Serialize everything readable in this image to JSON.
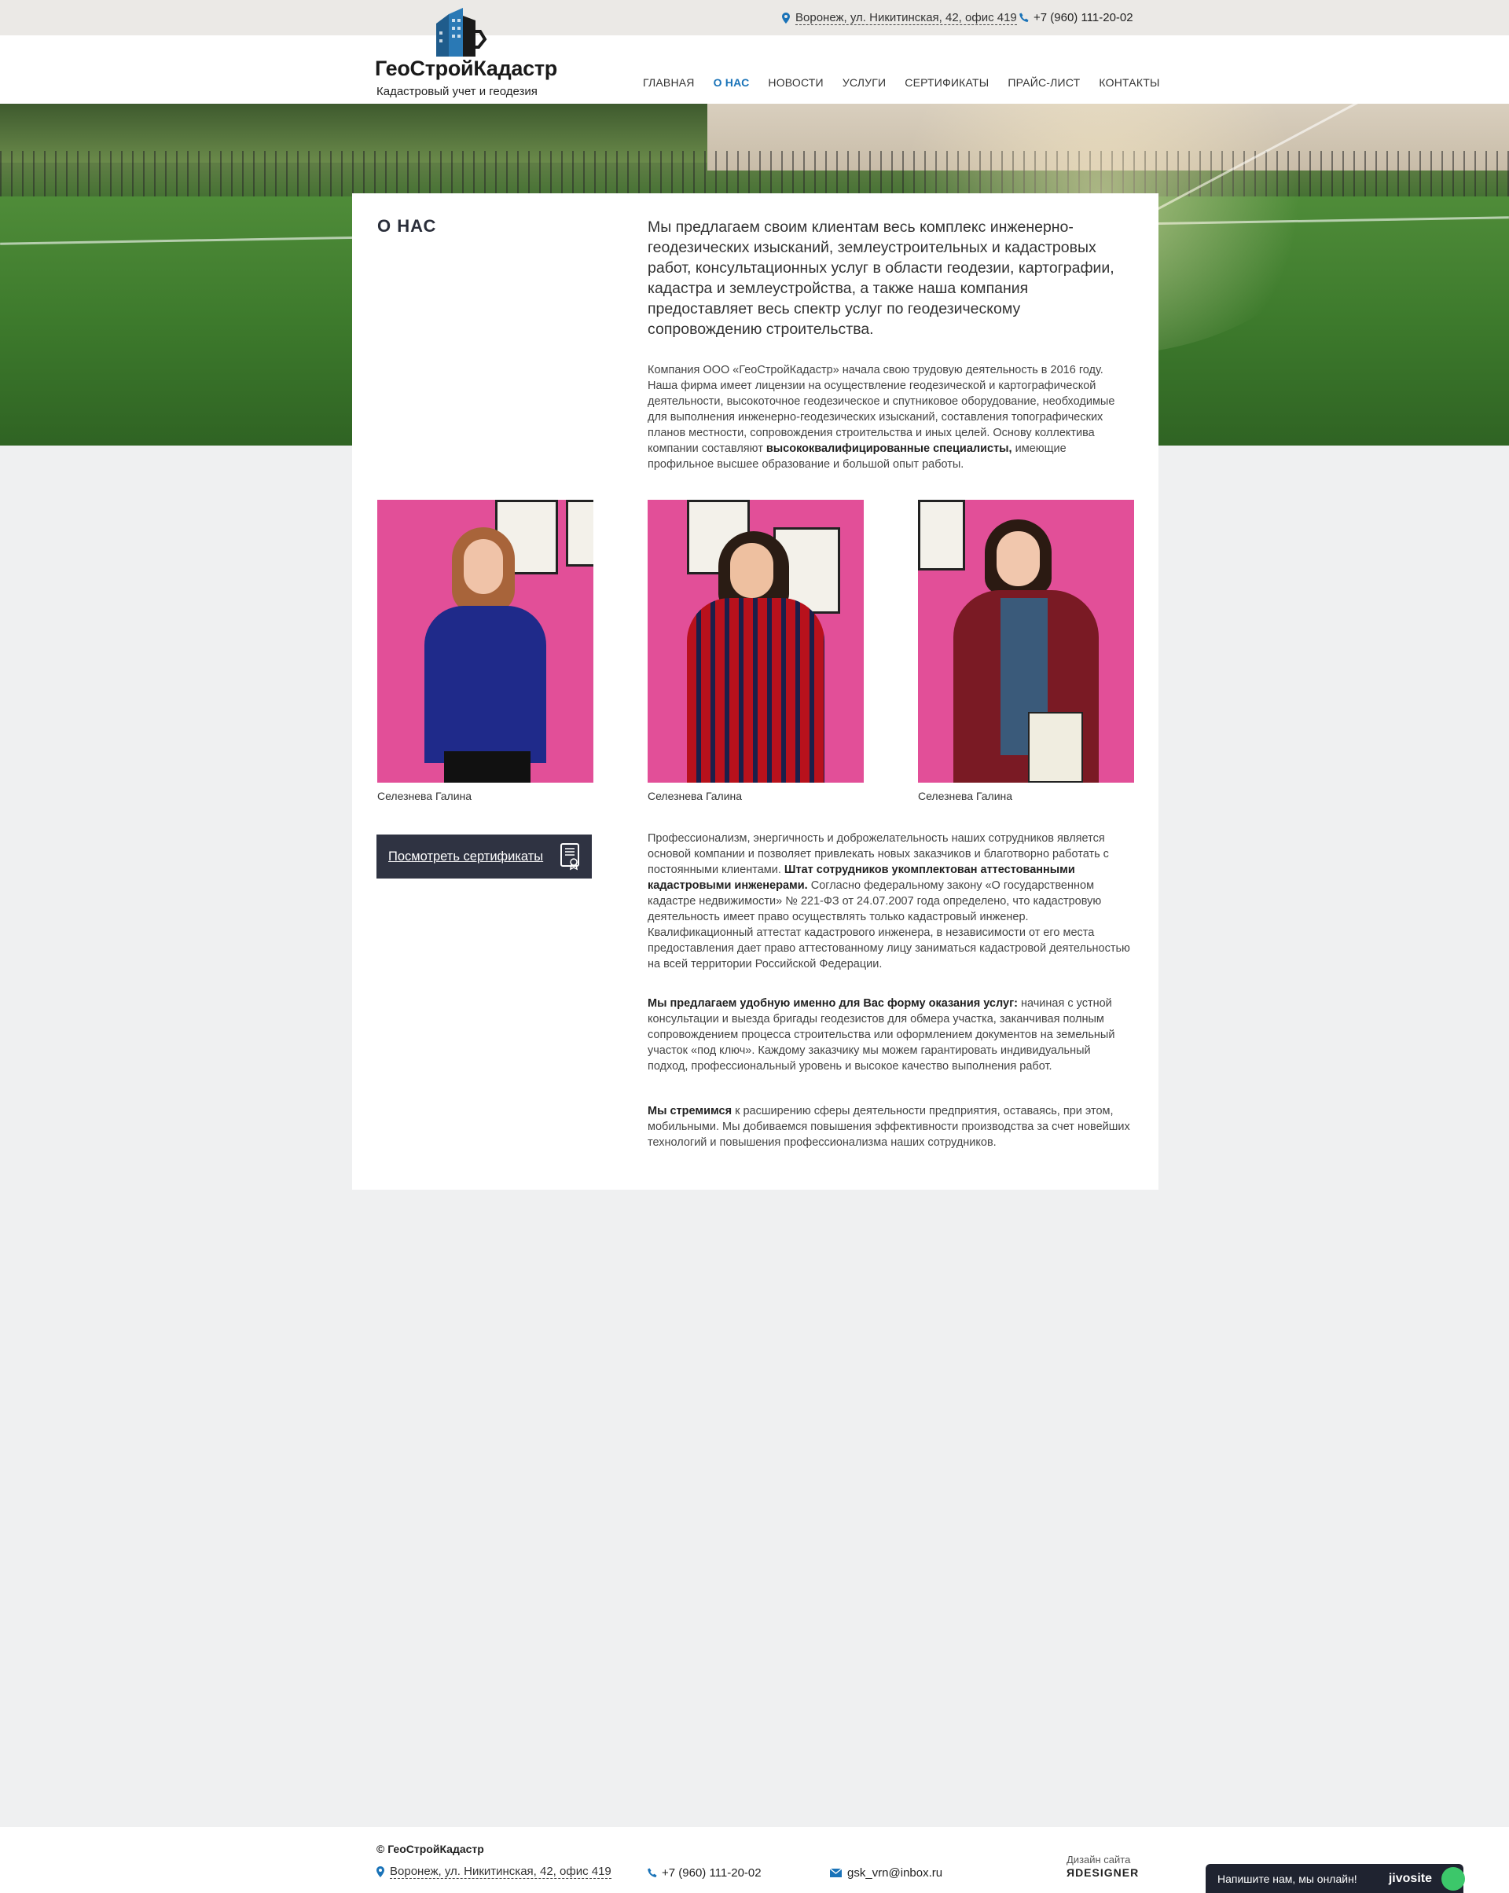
{
  "topbar": {
    "address": "Воронеж, ул. Никитинская, 42, офис 419",
    "phone": "+7 (960) 111-20-02"
  },
  "logo": {
    "name": "ГеоСтройКадастр",
    "tagline": "Кадастровый учет и геодезия"
  },
  "nav": {
    "items": [
      "ГЛАВНАЯ",
      "О НАС",
      "НОВОСТИ",
      "УСЛУГИ",
      "СЕРТИФИКАТЫ",
      "ПРАЙС-ЛИСТ",
      "КОНТАКТЫ"
    ],
    "active": "О НАС"
  },
  "about": {
    "title": "О НАС",
    "lead": "Мы предлагаем своим клиентам весь комплекс инженерно-геодезических изысканий, землеустроительных и кадастровых работ, консультационных услуг в области геодезии, картографии, кадастра и землеустройства, а также наша компания предоставляет весь спектр услуг по геодезическому сопровождению строительства.",
    "intro_text": "Компания ООО «ГеоСтройКадастр» начала свою трудовую деятельность в 2016 году. Наша фирма имеет лицензии на осуществление геодезической и картографической деятельности, высокоточное геодезическое и спутниковое оборудование, необходимые для выполнения инженерно-геодезических изысканий, составления топографических планов местности, сопровождения строительства и иных целей. Основу коллектива компании составляют ",
    "intro_bold": "высококвалифицированные специалисты,",
    "intro_tail": " имеющие профильное высшее образование и большой опыт работы."
  },
  "staff": [
    {
      "name": "Селезнева Галина"
    },
    {
      "name": "Селезнева Галина"
    },
    {
      "name": "Селезнева Галина"
    }
  ],
  "cert_button": {
    "label": "Посмотреть сертификаты"
  },
  "paragraphs": {
    "p1_a": "Профессионализм, энергичность и доброжелательность наших сотрудников является основой компании и позволяет привлекать новых заказчиков и благотворно работать с постоянными клиентами. ",
    "p1_bold": "Штат сотрудников укомплектован аттестованными кадастровыми инженерами.",
    "p1_b": " Согласно федеральному закону «О государственном кадастре недвижимости» № 221-ФЗ от 24.07.2007 года определено, что кадастровую деятельность имеет право осуществлять только кадастровый инженер. Квалификационный аттестат кадастрового инженера, в независимости от его места предоставления дает право аттестованному лицу заниматься кадастровой деятельностью на всей территории Российской Федерации.",
    "p2_bold": "Мы предлагаем удобную именно для Вас форму оказания услуг:",
    "p2": " начиная с устной консультации и выезда бригады геодезистов для обмера участка, заканчивая полным сопровождением процесса строительства или оформлением документов на земельный участок «под ключ». Каждому заказчику мы можем гарантировать индивидуальный подход, профессиональный уровень и высокое качество выполнения работ.",
    "p3_bold": "Мы стремимся",
    "p3": " к расширению сферы деятельности предприятия, оставаясь, при этом, мобильными. Мы добиваемся повышения эффективности производства за счет новейших технологий и повышения профессионализма наших сотрудников."
  },
  "footer": {
    "brand": "© ГеоСтройКадастр",
    "address": "Воронеж, ул. Никитинская, 42, офис 419",
    "phone": "+7 (960) 111-20-02",
    "email": "gsk_vrn@inbox.ru",
    "design_label": "Дизайн сайта",
    "design_brand": "ЯDESIGNER"
  },
  "chat": {
    "label": "Напишите нам, мы онлайн!",
    "brand": "jivosite"
  },
  "colors": {
    "accent": "#1a73b8",
    "dark": "#2f3342",
    "photo_bg": "#e24f98"
  }
}
